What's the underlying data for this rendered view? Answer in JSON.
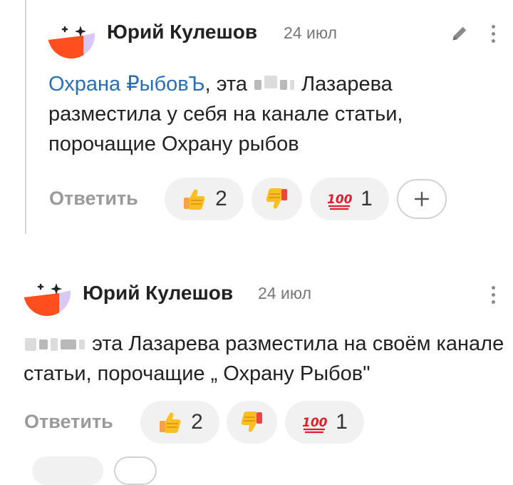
{
  "comments": [
    {
      "author": "Юрий Кулешов",
      "date": "24 июл",
      "mention": "Охрана ₽ыбовЪ",
      "text_part1": ", эта",
      "text_part2": "Лазарева разместила у себя на канале статьи, порочащие Охрану рыбов",
      "reply_label": "Ответить",
      "reactions": [
        {
          "emoji": "thumbs-up",
          "count": "2"
        },
        {
          "emoji": "thumbs-down",
          "count": ""
        },
        {
          "emoji": "hundred-points",
          "count": "1"
        }
      ],
      "has_edit": true,
      "has_add_reaction": true
    },
    {
      "author": "Юрий Кулешов",
      "date": "24 июл",
      "text_part1": "",
      "text_part2": "эта Лазарева разместила на своём канале статьи, порочащие „ Охрану Рыбов\"",
      "reply_label": "Ответить",
      "reactions": [
        {
          "emoji": "thumbs-up",
          "count": "2"
        },
        {
          "emoji": "thumbs-down",
          "count": ""
        },
        {
          "emoji": "hundred-points",
          "count": "1"
        }
      ]
    }
  ],
  "colors": {
    "mention": "#2a6fb4",
    "avatar_orange": "#ff4f1f",
    "avatar_lilac": "#d9c8f5"
  }
}
